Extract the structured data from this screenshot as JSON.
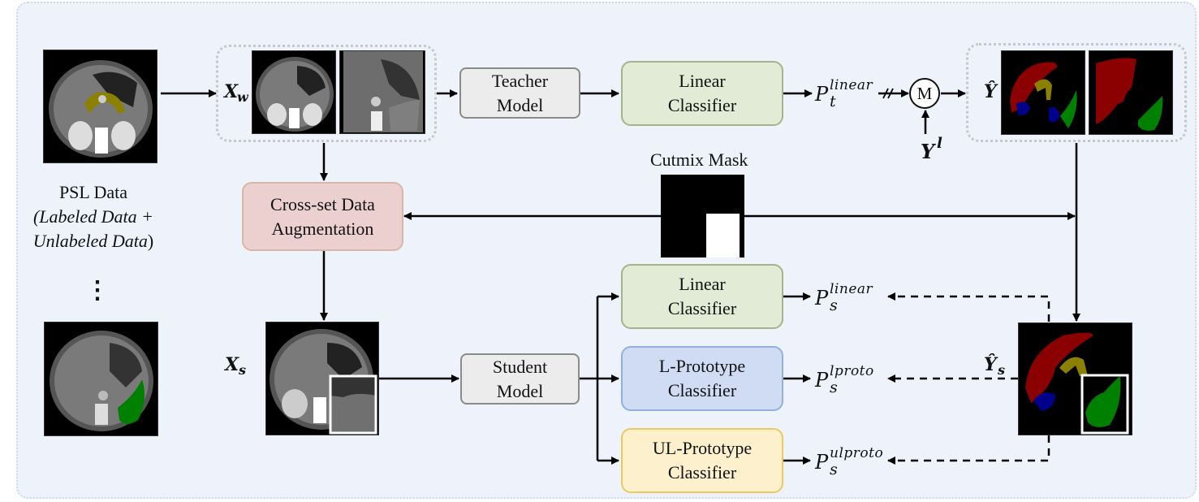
{
  "diagram": {
    "input": {
      "title": "PSL Data",
      "subtitle_italic_1": "(Labeled Data +",
      "subtitle_italic_2": "Unlabeled Data",
      "subtitle_close": ")",
      "ellipsis": "⋮"
    },
    "labels": {
      "xw_main": "X",
      "xw_sub": "w",
      "xs_main": "X",
      "xs_sub": "s",
      "yhat": "Ŷ",
      "ys_main": "Ŷ",
      "ys_sub": "s",
      "yl_main": "Y",
      "yl_sup": "l",
      "cutmix": "Cutmix Mask",
      "merge": "M",
      "stop_grad": "//"
    },
    "boxes": {
      "teacher": [
        "Teacher",
        "Model"
      ],
      "teacher_linear": [
        "Linear",
        "Classifier"
      ],
      "augmentation": [
        "Cross-set Data",
        "Augmentation"
      ],
      "student": [
        "Student",
        "Model"
      ],
      "student_linear": [
        "Linear",
        "Classifier"
      ],
      "lproto": [
        "L-Prototype",
        "Classifier"
      ],
      "ulproto": [
        "UL-Prototype",
        "Classifier"
      ]
    },
    "outputs": {
      "pt_linear": {
        "main": "P",
        "sub": "t",
        "sup": "linear"
      },
      "ps_linear": {
        "main": "P",
        "sub": "s",
        "sup": "linear"
      },
      "ps_lproto": {
        "main": "P",
        "sub": "s",
        "sup": "lproto"
      },
      "ps_ulproto": {
        "main": "P",
        "sub": "s",
        "sup": "ulproto"
      }
    },
    "segmentation_colors": {
      "liver": "#8b0000",
      "pancreas": "#8b8000",
      "kidney": "#00008b",
      "spleen": "#008000"
    }
  }
}
